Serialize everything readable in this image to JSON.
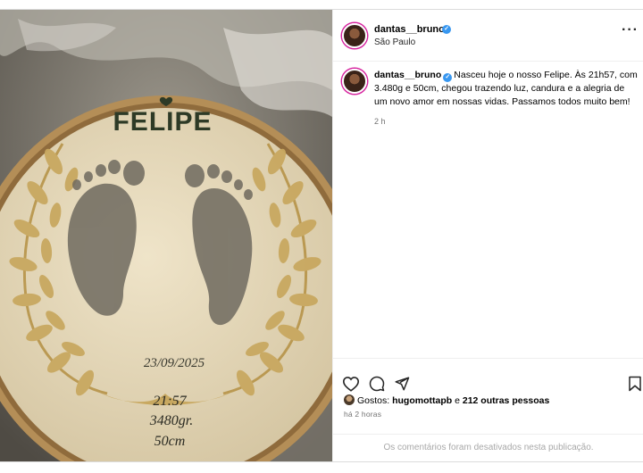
{
  "post": {
    "username": "dantas__bruno",
    "location": "São Paulo",
    "verified_mark": "✓",
    "more_label": "···",
    "caption_text": "Nasceu hoje o nosso Felipe. Às 21h57, com 3.480g e 50cm, chegou trazendo luz, candura e a alegria de um novo amor em nossas vidas. Passamos todos muito bem!",
    "caption_time": "2 h",
    "likes_prefix": "Gostos: ",
    "likes_user": "hugomottapb",
    "likes_middle": " e ",
    "likes_others": "212 outras pessoas",
    "posted_ago": "há 2 horas",
    "comments_disabled": "Os comentários foram desativados nesta publicação."
  },
  "photo": {
    "embroidery_name": "FELIPE",
    "date": "23/09/2025",
    "time": "21:57",
    "weight": "3480gr.",
    "length": "50cm"
  },
  "icons": {
    "like": "heart-icon",
    "comment": "comment-icon",
    "share": "send-icon",
    "save": "bookmark-icon",
    "more": "more-icon"
  },
  "colors": {
    "verified": "#3897f0",
    "muted": "#737373",
    "thread": "#c8a860"
  }
}
